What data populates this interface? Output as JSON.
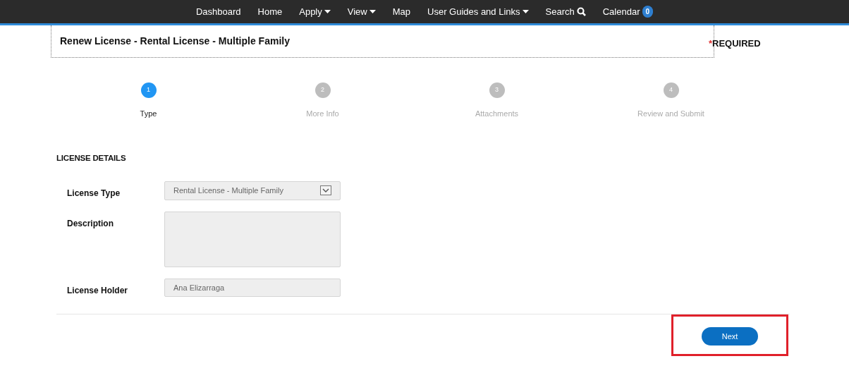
{
  "nav": [
    {
      "label": "Dashboard",
      "kind": "link"
    },
    {
      "label": "Home",
      "kind": "link"
    },
    {
      "label": "Apply",
      "kind": "dropdown"
    },
    {
      "label": "View",
      "kind": "dropdown"
    },
    {
      "label": "Map",
      "kind": "link"
    },
    {
      "label": "User Guides and Links",
      "kind": "dropdown"
    },
    {
      "label": "Search",
      "kind": "search"
    },
    {
      "label": "Calendar",
      "kind": "badge",
      "badge": "0"
    }
  ],
  "header": {
    "title": "Renew License - Rental License - Multiple Family",
    "required_mark": "*",
    "required": "REQUIRED"
  },
  "steps": [
    {
      "number": "1",
      "label": "Type",
      "selected": true
    },
    {
      "number": "2",
      "label": "More Info",
      "selected": false
    },
    {
      "number": "3",
      "label": "Attachments",
      "selected": false
    },
    {
      "number": "4",
      "label": "Review and Submit",
      "selected": false
    }
  ],
  "section_title": "LICENSE DETAILS",
  "fields": [
    {
      "label": "License Type",
      "kind": "select",
      "value": "Rental License - Multiple Family",
      "disabled": true
    },
    {
      "label": "Description",
      "kind": "textarea",
      "disabled": true
    },
    {
      "label": "License Holder",
      "kind": "text",
      "value": "Ana Elizarraga",
      "disabled": true
    }
  ],
  "next_button": {
    "label": "Next",
    "highlighted": true
  }
}
